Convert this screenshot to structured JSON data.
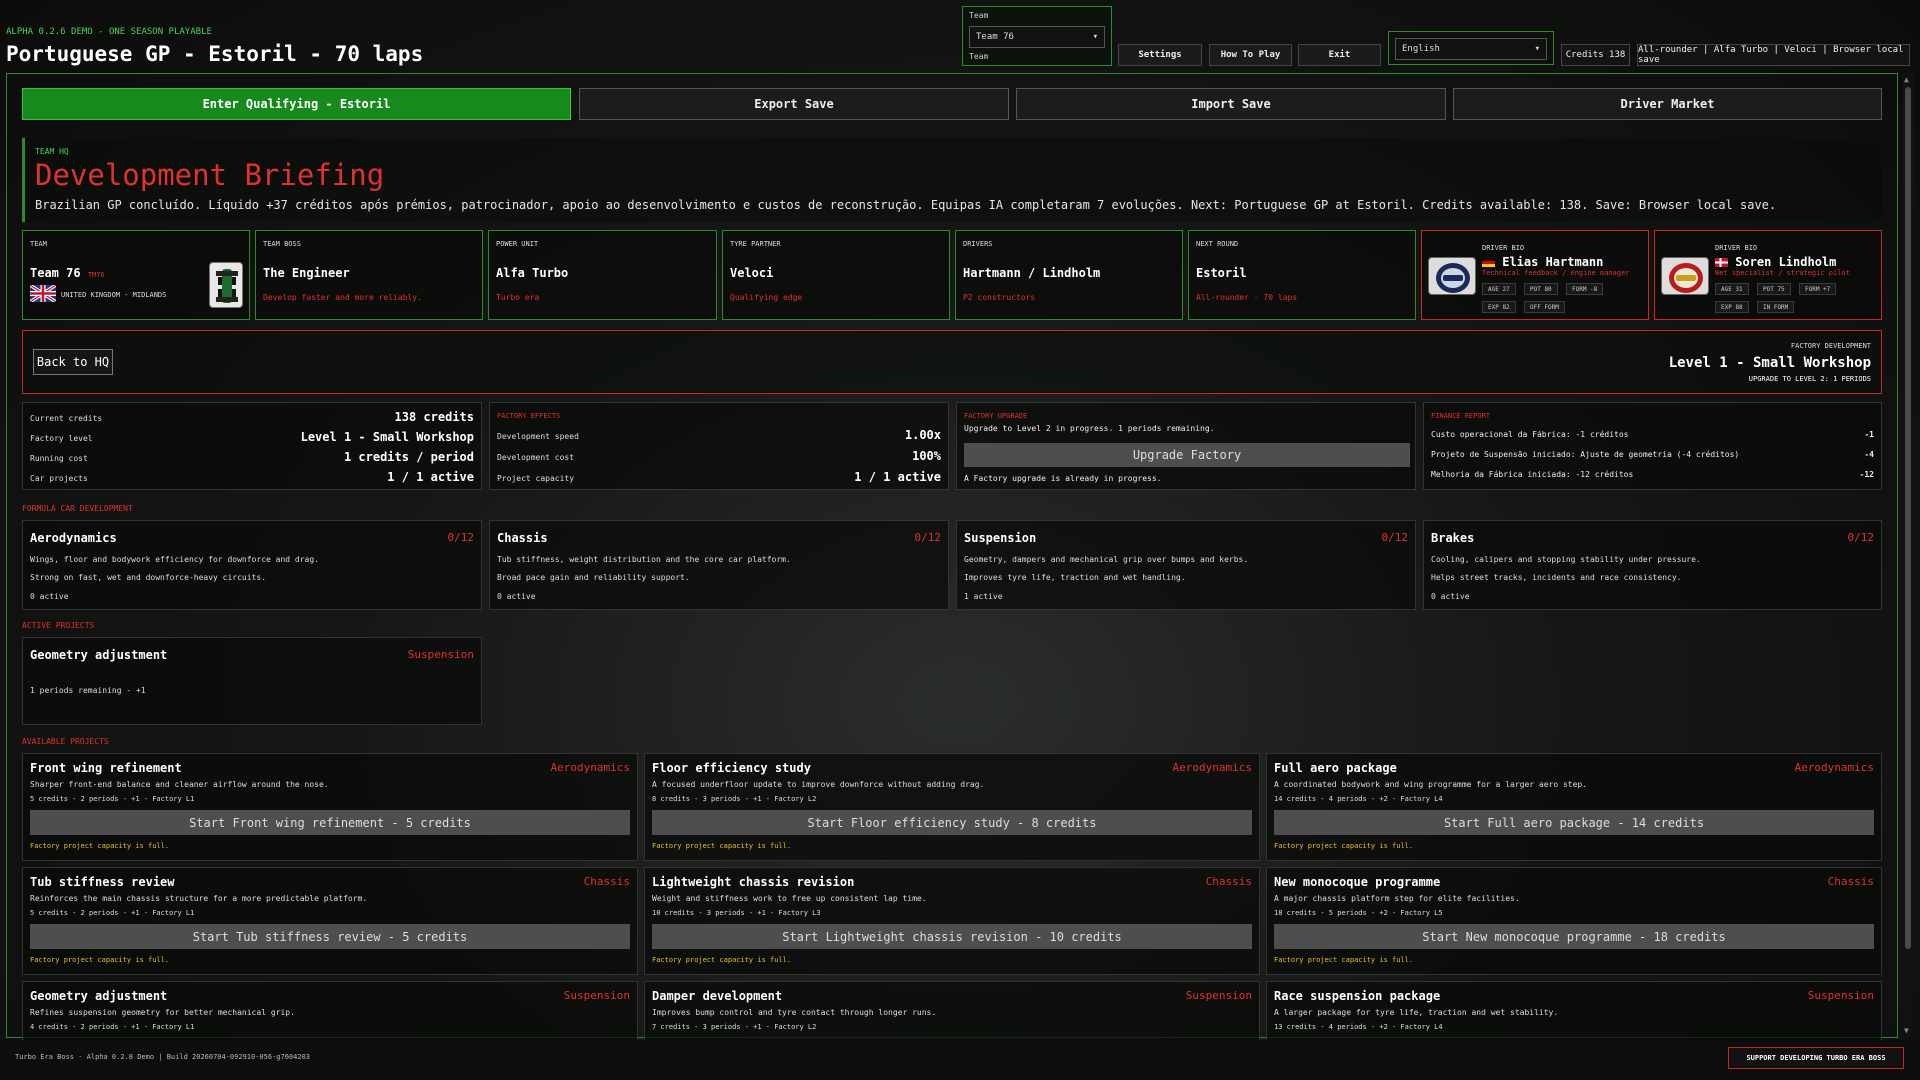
{
  "header": {
    "alpha_line": "ALPHA 0.2.6 DEMO - ONE SEASON PLAYABLE",
    "title": "Portuguese GP - Estoril - 70 laps",
    "team_label_top": "Team",
    "team_value": "Team 76",
    "team_label_bottom": "Team",
    "settings": "Settings",
    "how_to_play": "How To Play",
    "exit": "Exit",
    "language": "English",
    "credits_tag": "Credits 138",
    "profile_tag": "All-rounder | Alfa Turbo | Veloci | Browser local save"
  },
  "actions": {
    "qualifying": "Enter Qualifying - Estoril",
    "export": "Export Save",
    "import": "Import Save",
    "market": "Driver Market"
  },
  "briefing": {
    "kicker": "TEAM HQ",
    "title": "Development Briefing",
    "text": "Brazilian GP concluído. Líquido +37 créditos após prémios, patrocinador, apoio ao desenvolvimento e custos de reconstrução. Equipas IA completaram 7 evoluções. Next: Portuguese GP at Estoril. Credits available: 138. Save: Browser local save."
  },
  "cards": {
    "team": {
      "k": "TEAM",
      "v": "Team 76",
      "tag": "TM76",
      "s": "UNITED KINGDOM - MIDLANDS"
    },
    "boss": {
      "k": "TEAM BOSS",
      "v": "The Engineer",
      "s": "Develop faster and more reliably."
    },
    "power": {
      "k": "POWER UNIT",
      "v": "Alfa Turbo",
      "s": "Turbo era"
    },
    "tyre": {
      "k": "TYRE PARTNER",
      "v": "Veloci",
      "s": "Qualifying edge"
    },
    "drivers": {
      "k": "DRIVERS",
      "v": "Hartmann / Lindholm",
      "s": "P2 constructors"
    },
    "next": {
      "k": "NEXT ROUND",
      "v": "Estoril",
      "s": "All-rounder - 70 laps"
    }
  },
  "driver_bios": [
    {
      "k": "DRIVER BIO",
      "name": "Elias Hartmann",
      "sub": "Technical feedback / engine manager",
      "pills": [
        "AGE 27",
        "POT 80",
        "FORM -8",
        "EXP 82",
        "OFF FORM"
      ]
    },
    {
      "k": "DRIVER BIO",
      "name": "Soren Lindholm",
      "sub": "Wet specialist / strategic pilot",
      "pills": [
        "AGE 31",
        "POT 75",
        "FORM +7",
        "EXP 88",
        "IN FORM"
      ]
    }
  ],
  "factory": {
    "back": "Back to HQ",
    "k": "FACTORY DEVELOPMENT",
    "level": "Level 1 - Small Workshop",
    "sub": "UPGRADE TO LEVEL 2: 1 PERIODS"
  },
  "stats": {
    "current_credits": {
      "l": "Current credits",
      "r": "138 credits"
    },
    "factory_level": {
      "l": "Factory level",
      "r": "Level 1 - Small Workshop"
    },
    "running_cost": {
      "l": "Running cost",
      "r": "1 credits / period"
    },
    "car_projects": {
      "l": "Car projects",
      "r": "1 / 1 active"
    }
  },
  "effects": {
    "title": "FACTORY EFFECTS",
    "speed": {
      "l": "Development speed",
      "r": "1.00x"
    },
    "cost": {
      "l": "Development cost",
      "r": "100%"
    },
    "capacity": {
      "l": "Project capacity",
      "r": "1 / 1 active"
    }
  },
  "upgrade": {
    "title": "FACTORY UPGRADE",
    "status": "Upgrade to Level 2 in progress. 1 periods remaining.",
    "button": "Upgrade Factory",
    "note": "A Factory upgrade is already in progress."
  },
  "finance": {
    "title": "FINANCE REPORT",
    "rows": [
      {
        "l": "Custo operacional da Fábrica: -1 créditos",
        "r": "-1"
      },
      {
        "l": "Projeto de Suspensão iniciado: Ajuste de geometria (-4 créditos)",
        "r": "-4"
      },
      {
        "l": "Melhoria da Fábrica iniciada: -12 créditos",
        "r": "-12"
      }
    ]
  },
  "sections": {
    "formula": "FORMULA CAR DEVELOPMENT",
    "active": "ACTIVE PROJECTS",
    "available": "AVAILABLE PROJECTS"
  },
  "areas": [
    {
      "t": "Aerodynamics",
      "c": "0/12",
      "d1": "Wings, floor and bodywork efficiency for downforce and drag.",
      "d2": "Strong on fast, wet and downforce-heavy circuits.",
      "a": "0 active"
    },
    {
      "t": "Chassis",
      "c": "0/12",
      "d1": "Tub stiffness, weight distribution and the core car platform.",
      "d2": "Broad pace gain and reliability support.",
      "a": "0 active"
    },
    {
      "t": "Suspension",
      "c": "0/12",
      "d1": "Geometry, dampers and mechanical grip over bumps and kerbs.",
      "d2": "Improves tyre life, traction and wet handling.",
      "a": "1 active"
    },
    {
      "t": "Brakes",
      "c": "0/12",
      "d1": "Cooling, calipers and stopping stability under pressure.",
      "d2": "Helps street tracks, incidents and race consistency.",
      "a": "0 active"
    }
  ],
  "active_project": {
    "t": "Geometry adjustment",
    "c": "Suspension",
    "d": "1 periods remaining - +1"
  },
  "projects": [
    {
      "t": "Front wing refinement",
      "c": "Aerodynamics",
      "d": "Sharper front-end balance and cleaner airflow around the nose.",
      "m": "5 credits - 2 periods - +1 - Factory L1",
      "b": "Start Front wing refinement - 5 credits",
      "f": "Factory project capacity is full."
    },
    {
      "t": "Floor efficiency study",
      "c": "Aerodynamics",
      "d": "A focused underfloor update to improve downforce without adding drag.",
      "m": "8 credits - 3 periods - +1 - Factory L2",
      "b": "Start Floor efficiency study - 8 credits",
      "f": "Factory project capacity is full."
    },
    {
      "t": "Full aero package",
      "c": "Aerodynamics",
      "d": "A coordinated bodywork and wing programme for a larger aero step.",
      "m": "14 credits - 4 periods - +2 - Factory L4",
      "b": "Start Full aero package - 14 credits",
      "f": "Factory project capacity is full."
    },
    {
      "t": "Tub stiffness review",
      "c": "Chassis",
      "d": "Reinforces the main chassis structure for a more predictable platform.",
      "m": "5 credits - 2 periods - +1 - Factory L1",
      "b": "Start Tub stiffness review - 5 credits",
      "f": "Factory project capacity is full."
    },
    {
      "t": "Lightweight chassis revision",
      "c": "Chassis",
      "d": "Weight and stiffness work to free up consistent lap time.",
      "m": "10 credits - 3 periods - +1 - Factory L3",
      "b": "Start Lightweight chassis revision - 10 credits",
      "f": "Factory project capacity is full."
    },
    {
      "t": "New monocoque programme",
      "c": "Chassis",
      "d": "A major chassis platform step for elite facilities.",
      "m": "18 credits - 5 periods - +2 - Factory L5",
      "b": "Start New monocoque programme - 18 credits",
      "f": "Factory project capacity is full."
    },
    {
      "t": "Geometry adjustment",
      "c": "Suspension",
      "d": "Refines suspension geometry for better mechanical grip.",
      "m": "4 credits - 2 periods - +1 - Factory L1",
      "b": "",
      "f": ""
    },
    {
      "t": "Damper development",
      "c": "Suspension",
      "d": "Improves bump control and tyre contact through longer runs.",
      "m": "7 credits - 3 periods - +1 - Factory L2",
      "b": "",
      "f": ""
    },
    {
      "t": "Race suspension package",
      "c": "Suspension",
      "d": "A larger package for tyre life, traction and wet stability.",
      "m": "13 credits - 4 periods - +2 - Factory L4",
      "b": "",
      "f": ""
    }
  ],
  "footer": {
    "build": "Turbo Era Boss - Alpha 0.2.8 Demo | Build 20260704-092910-056-g7604203",
    "support": "SUPPORT DEVELOPING TURBO ERA BOSS"
  },
  "colors": {
    "green": "#168a1d",
    "red": "#e0322c",
    "yellow": "#e8c020"
  }
}
